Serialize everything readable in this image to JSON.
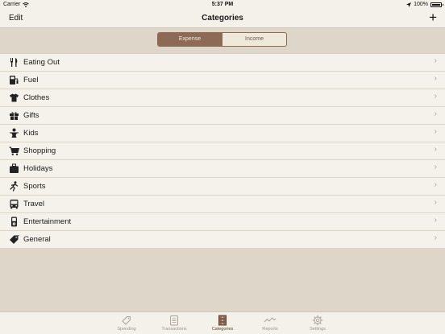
{
  "status": {
    "carrier": "Carrier",
    "time": "5:37 PM",
    "battery": "100%"
  },
  "nav": {
    "edit": "Edit",
    "title": "Categories",
    "add": "+"
  },
  "segment": {
    "options": [
      "Expense",
      "Income"
    ],
    "selected": "Expense"
  },
  "categories": [
    {
      "label": "Eating Out",
      "icon": "fork-knife-icon"
    },
    {
      "label": "Fuel",
      "icon": "fuel-pump-icon"
    },
    {
      "label": "Clothes",
      "icon": "tshirt-icon"
    },
    {
      "label": "Gifts",
      "icon": "gift-icon"
    },
    {
      "label": "Kids",
      "icon": "baby-icon"
    },
    {
      "label": "Shopping",
      "icon": "shopping-cart-icon"
    },
    {
      "label": "Holidays",
      "icon": "suitcase-icon"
    },
    {
      "label": "Sports",
      "icon": "runner-icon"
    },
    {
      "label": "Travel",
      "icon": "bus-icon"
    },
    {
      "label": "Entertainment",
      "icon": "media-player-icon"
    },
    {
      "label": "General",
      "icon": "price-tag-icon"
    }
  ],
  "tabs": [
    {
      "label": "Spending",
      "icon": "tag-icon"
    },
    {
      "label": "Transactions",
      "icon": "notepad-icon"
    },
    {
      "label": "Categories",
      "icon": "drawers-icon",
      "active": true
    },
    {
      "label": "Reports",
      "icon": "line-chart-icon"
    },
    {
      "label": "Settings",
      "icon": "gear-icon"
    }
  ],
  "colors": {
    "accent": "#8c6a55",
    "background": "#ddd6c9",
    "list": "#f5f2eb"
  }
}
